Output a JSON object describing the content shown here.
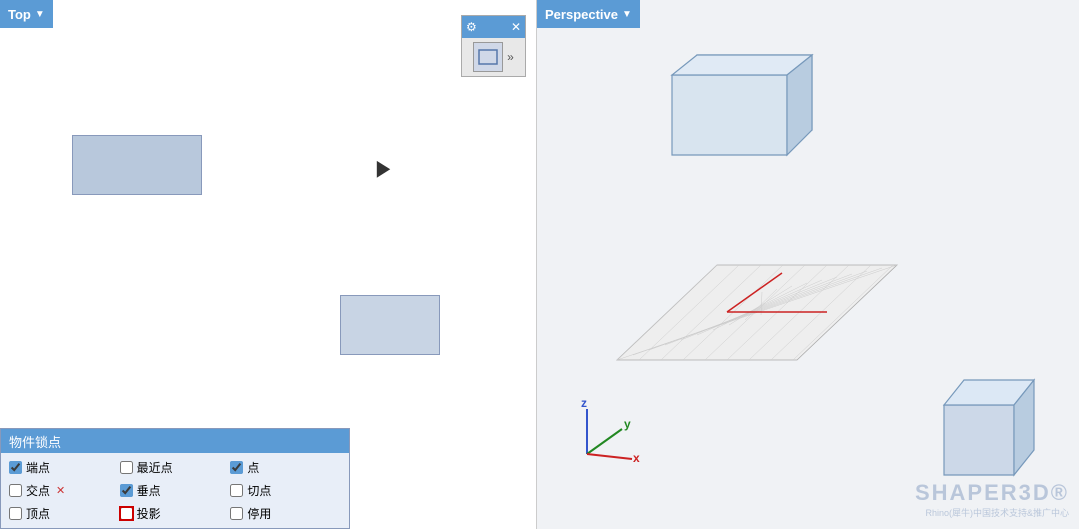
{
  "left_viewport": {
    "header": "Top",
    "dropdown_arrow": "▼"
  },
  "right_viewport": {
    "header": "Perspective",
    "dropdown_arrow": "▼"
  },
  "toolbar_panel": {
    "gear_icon": "⚙",
    "close_icon": "✕",
    "expand_icon": "»"
  },
  "osnap": {
    "title": "物件锁点",
    "items": [
      {
        "label": "端点",
        "checked": true,
        "col": 1
      },
      {
        "label": "最近点",
        "checked": false,
        "col": 2
      },
      {
        "label": "点",
        "checked": true,
        "col": 3
      },
      {
        "label": "交点",
        "checked": false,
        "col": 1
      },
      {
        "label": "垂点",
        "checked": true,
        "col": 2
      },
      {
        "label": "切点",
        "checked": false,
        "col": 3
      },
      {
        "label": "顶点",
        "checked": false,
        "col": 1
      },
      {
        "label": "投影",
        "checked": false,
        "col": 2
      },
      {
        "label": "停用",
        "checked": false,
        "col": 3
      }
    ]
  },
  "watermark": {
    "line1": "SHAPER3D®",
    "line2": "Rhino(犀牛)中国技术支持&推广中心"
  },
  "axis": {
    "z": "z",
    "y": "y",
    "x": "x"
  }
}
